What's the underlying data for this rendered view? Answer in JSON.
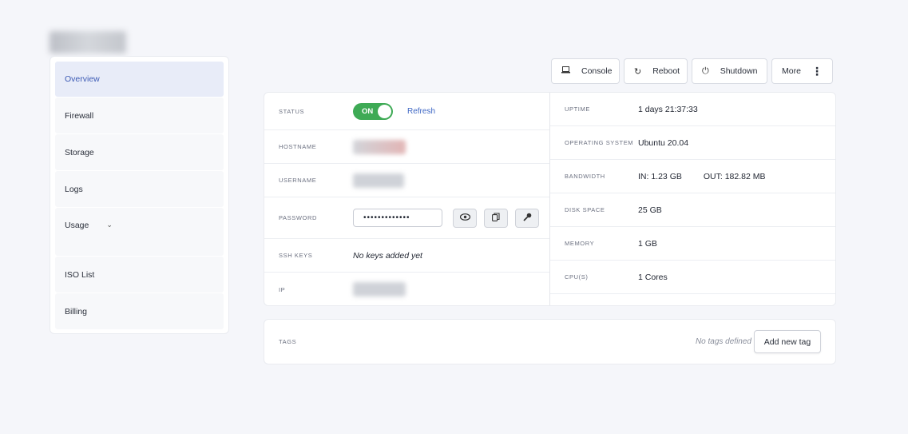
{
  "sidebar": {
    "items": [
      {
        "label": "Overview"
      },
      {
        "label": "Firewall"
      },
      {
        "label": "Storage"
      },
      {
        "label": "Logs"
      },
      {
        "label": "Usage"
      },
      {
        "label": "ISO List"
      },
      {
        "label": "Billing"
      }
    ]
  },
  "toolbar": {
    "console": "Console",
    "reboot": "Reboot",
    "shutdown": "Shutdown",
    "more": "More"
  },
  "status": {
    "label": "STATUS",
    "toggle": "ON",
    "refresh": "Refresh",
    "toggle_color": "#3eaa55"
  },
  "left_fields": {
    "hostname_label": "HOSTNAME",
    "username_label": "USERNAME",
    "password_label": "PASSWORD",
    "password_mask": "•••••••••••••",
    "ssh_label": "SSH KEYS",
    "ssh_value": "No keys added yet",
    "ip_label": "IP"
  },
  "right_fields": {
    "uptime_label": "UPTIME",
    "uptime_value": "1 days 21:37:33",
    "os_label": "OPERATING SYSTEM",
    "os_value": "Ubuntu 20.04",
    "bandwidth_label": "BANDWIDTH",
    "bandwidth_in": "IN: 1.23 GB",
    "bandwidth_out": "OUT: 182.82 MB",
    "disk_label": "DISK SPACE",
    "disk_value": "25 GB",
    "memory_label": "MEMORY",
    "memory_value": "1 GB",
    "cpu_label": "CPU(S)",
    "cpu_value": "1 Cores"
  },
  "tags": {
    "label": "TAGS",
    "empty": "No tags defined",
    "add": "Add new tag"
  },
  "icons": {
    "console": "laptop-icon",
    "reboot": "refresh-icon",
    "shutdown": "power-icon",
    "more": "vertical-dots-icon",
    "eye": "eye-icon",
    "copy": "copy-icon",
    "key": "key-icon",
    "chevron": "chevron-down-icon"
  }
}
